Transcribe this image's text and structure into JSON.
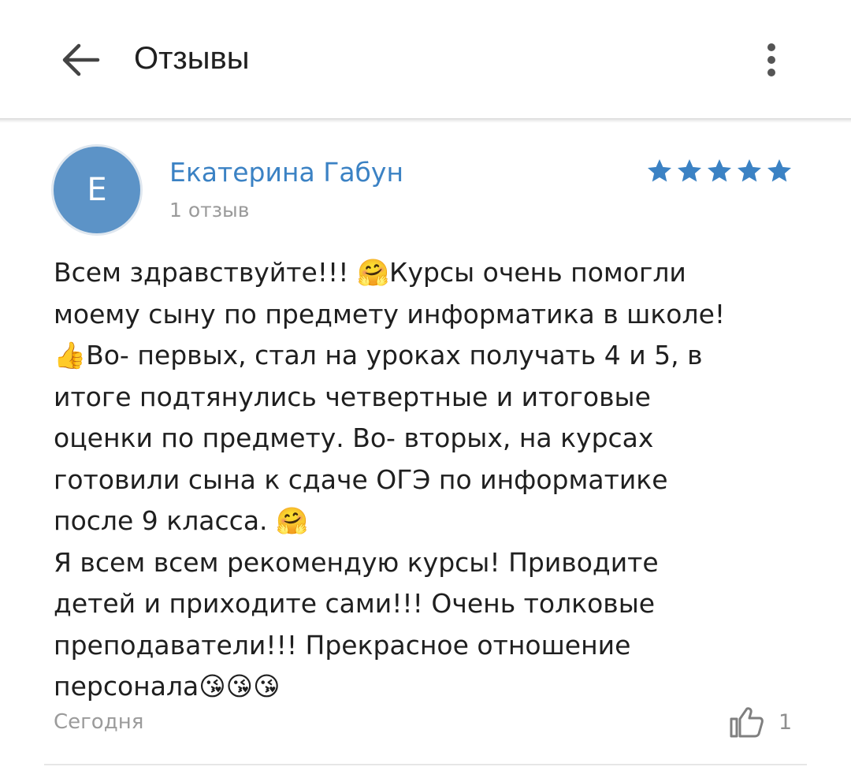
{
  "app_bar": {
    "title": "Отзывы",
    "back_icon": "arrow-left-icon",
    "more_icon": "more-vertical-icon"
  },
  "review": {
    "author": {
      "initial": "Е",
      "name": "Екатерина Габун",
      "reviews_count": "1 отзыв",
      "avatar_color": "#5c93c7"
    },
    "rating": 5,
    "rating_max": 5,
    "star_color": "#3b82c4",
    "text": "Всем здравствуйте!!! 🤗Курсы очень помогли\nмоему сыну по предмету информатика в школе!\n👍Во- первых, стал на уроках получать 4 и 5, в\nитоге подтянулись четвертные и итоговые\nоценки по предмету. Во- вторых, на курсах\nготовили сына к сдаче ОГЭ по информатике\nпосле 9 класса. 🤗\nЯ всем всем рекомендую курсы! Приводите\nдетей и приходите сами!!! Очень толковые\nпреподаватели!!! Прекрасное отношение\nперсонала😘😘😘",
    "date": "Сегодня",
    "likes": "1"
  },
  "colors": {
    "link": "#3b82c4",
    "secondary_text": "#9b9b9b",
    "divider": "#e6e6e6"
  }
}
